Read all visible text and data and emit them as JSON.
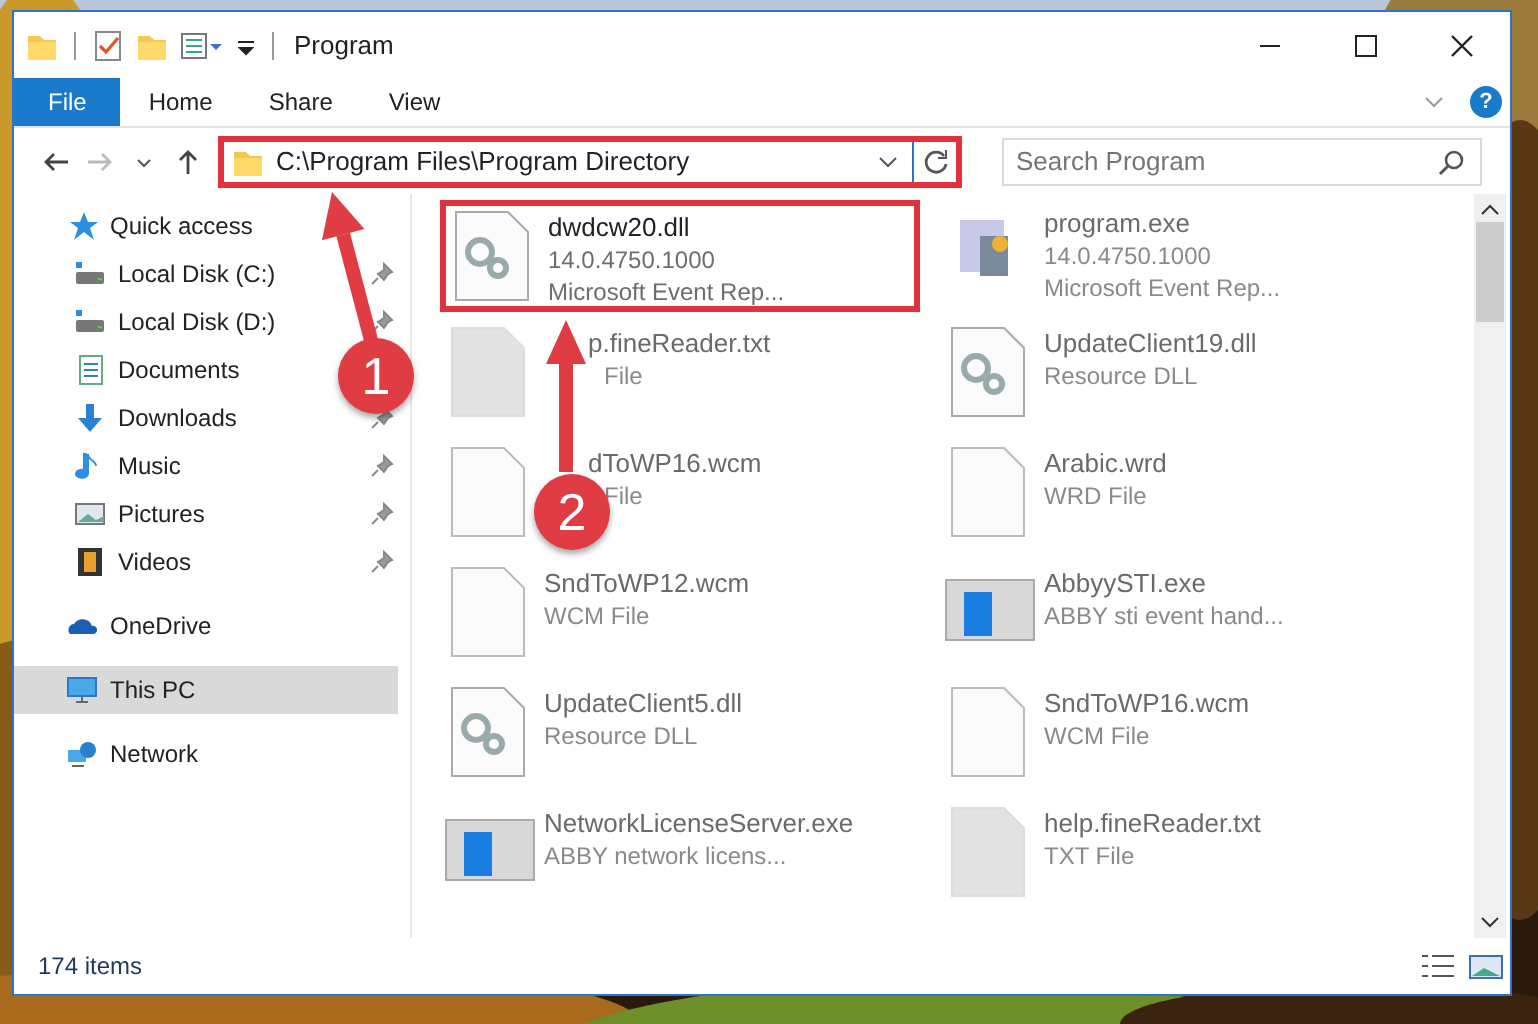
{
  "window": {
    "title": "Program"
  },
  "ribbon": {
    "tabs": [
      {
        "label": "File",
        "selected": true
      },
      {
        "label": "Home",
        "selected": false
      },
      {
        "label": "Share",
        "selected": false
      },
      {
        "label": "View",
        "selected": false
      }
    ],
    "help": "?"
  },
  "address": {
    "path": "C:\\Program Files\\Program Directory",
    "highlighted": true
  },
  "search": {
    "placeholder": "Search Program"
  },
  "sidebar": {
    "items": [
      {
        "label": "Quick access",
        "kind": "star",
        "selected": false,
        "children": [
          {
            "label": "Local Disk (C:)",
            "kind": "drive",
            "pinned": true,
            "selected": false
          },
          {
            "label": "Local Disk (D:)",
            "kind": "drive",
            "pinned": true,
            "selected": false
          },
          {
            "label": "Documents",
            "kind": "doc",
            "selected": false
          },
          {
            "label": "Downloads",
            "kind": "download",
            "pinned": true,
            "selected": false
          },
          {
            "label": "Music",
            "kind": "music",
            "pinned": true,
            "selected": false
          },
          {
            "label": "Pictures",
            "kind": "pictures",
            "pinned": true,
            "selected": false
          },
          {
            "label": "Videos",
            "kind": "videos",
            "pinned": true,
            "selected": false
          }
        ]
      },
      {
        "label": "OneDrive",
        "kind": "cloud",
        "selected": false
      },
      {
        "label": "This PC",
        "kind": "pc",
        "selected": true
      },
      {
        "label": "Network",
        "kind": "network",
        "selected": false
      }
    ]
  },
  "files": [
    {
      "name": "dwdcw20.dll",
      "lines": [
        "14.0.4750.1000",
        "Microsoft Event Rep..."
      ],
      "kind": "gear",
      "highlighted": true,
      "blurred": false
    },
    {
      "name": "program.exe",
      "lines": [
        "14.0.4750.1000",
        "Microsoft Event Rep..."
      ],
      "kind": "app",
      "highlighted": false,
      "blurred": true
    },
    {
      "name": "p.fineReader.txt",
      "lines": [
        "File"
      ],
      "kind": "grey",
      "highlighted": false,
      "blurred": true
    },
    {
      "name": "UpdateClient19.dll",
      "lines": [
        "Resource DLL"
      ],
      "kind": "gear",
      "highlighted": false,
      "blurred": true
    },
    {
      "name": "dToWP16.wcm",
      "lines": [
        "File"
      ],
      "kind": "blank",
      "highlighted": false,
      "blurred": true
    },
    {
      "name": "Arabic.wrd",
      "lines": [
        "WRD File"
      ],
      "kind": "blank",
      "highlighted": false,
      "blurred": true
    },
    {
      "name": "SndToWP12.wcm",
      "lines": [
        "WCM File"
      ],
      "kind": "blank",
      "highlighted": false,
      "blurred": true
    },
    {
      "name": "AbbyySTI.exe",
      "lines": [
        "ABBY sti event hand..."
      ],
      "kind": "window",
      "highlighted": false,
      "blurred": true
    },
    {
      "name": "UpdateClient5.dll",
      "lines": [
        "Resource DLL"
      ],
      "kind": "gear",
      "highlighted": false,
      "blurred": true
    },
    {
      "name": "SndToWP16.wcm",
      "lines": [
        "WCM File"
      ],
      "kind": "blank",
      "highlighted": false,
      "blurred": true
    },
    {
      "name": "NetworkLicenseServer.exe",
      "lines": [
        "ABBY network licens..."
      ],
      "kind": "window",
      "highlighted": false,
      "blurred": true
    },
    {
      "name": "help.fineReader.txt",
      "lines": [
        "TXT File"
      ],
      "kind": "grey",
      "highlighted": false,
      "blurred": true
    }
  ],
  "status_bar": {
    "count": "174 items"
  },
  "annotations": [
    {
      "number": "1"
    },
    {
      "number": "2"
    }
  ]
}
